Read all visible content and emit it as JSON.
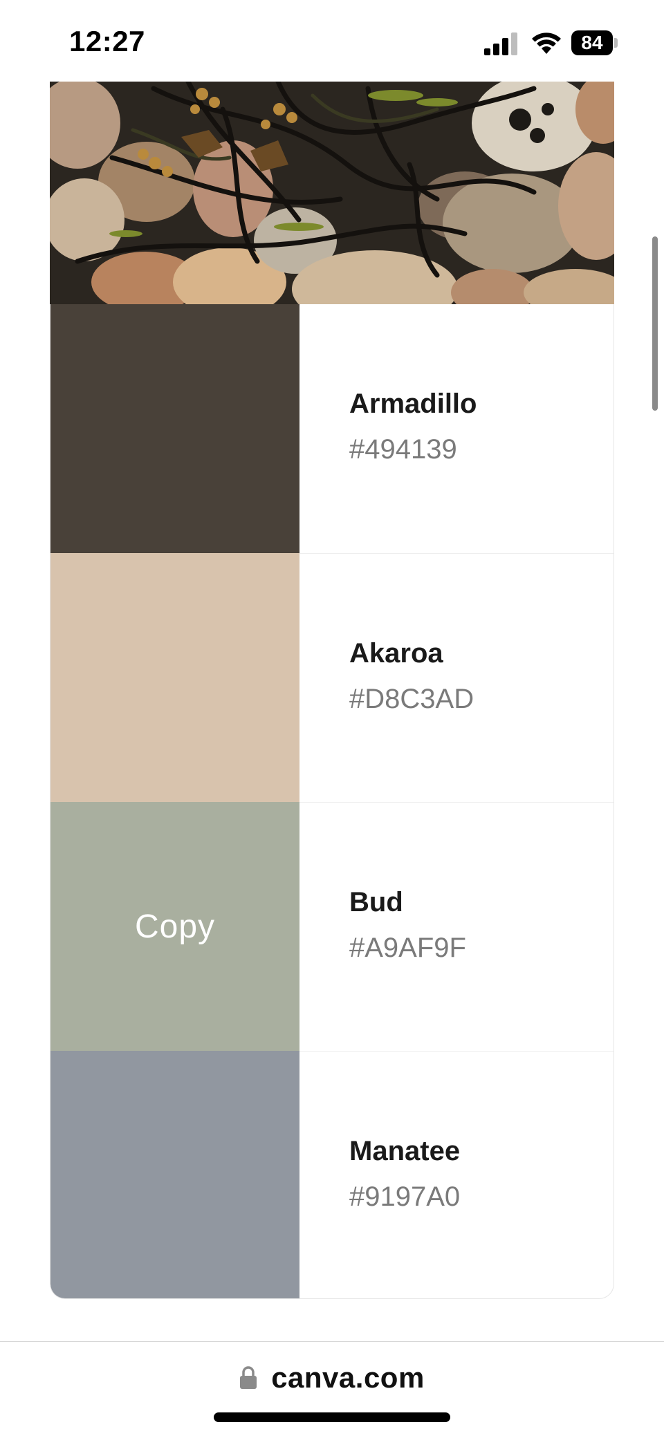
{
  "status_bar": {
    "time": "12:27",
    "battery": "84",
    "icons": [
      "signal-icon",
      "wifi-icon",
      "battery-icon"
    ]
  },
  "palette": {
    "colors": [
      {
        "name": "Armadillo",
        "hex": "#494139",
        "swatch": "#494139"
      },
      {
        "name": "Akaroa",
        "hex": "#D8C3AD",
        "swatch": "#D8C3AD"
      },
      {
        "name": "Bud",
        "hex": "#A9AF9F",
        "swatch": "#A9AF9F",
        "copy_label": "Copy"
      },
      {
        "name": "Manatee",
        "hex": "#9197A0",
        "swatch": "#9197A0"
      }
    ]
  },
  "browser": {
    "url": "canva.com",
    "icons": [
      "lock-icon"
    ]
  }
}
